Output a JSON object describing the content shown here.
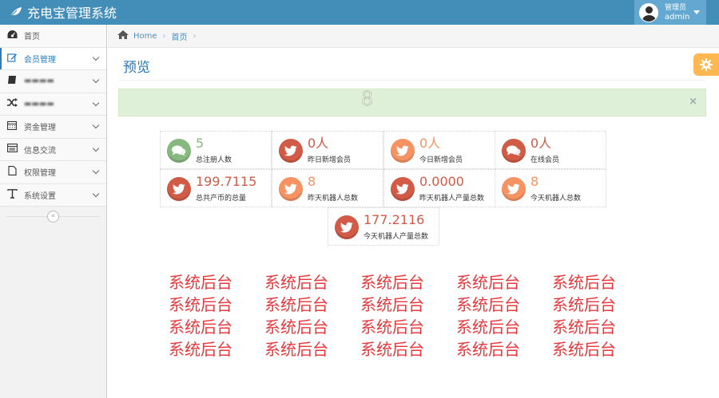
{
  "app": {
    "title": "充电宝管理系统"
  },
  "user": {
    "role": "管理员",
    "name": "admin"
  },
  "sidebar": {
    "items": [
      {
        "label": "首页",
        "icon": "dashboard-icon",
        "expandable": false
      },
      {
        "label": "会员管理",
        "icon": "edit-icon",
        "expandable": true,
        "active": true
      },
      {
        "label": "",
        "icon": "book-icon",
        "expandable": true,
        "obscured": true
      },
      {
        "label": "",
        "icon": "shuffle-icon",
        "expandable": true,
        "obscured": true
      },
      {
        "label": "资金管理",
        "icon": "calendar-icon",
        "expandable": true
      },
      {
        "label": "信息交流",
        "icon": "list-icon",
        "expandable": true
      },
      {
        "label": "权限管理",
        "icon": "file-icon",
        "expandable": true
      },
      {
        "label": "系统设置",
        "icon": "text-icon",
        "expandable": true
      }
    ],
    "collapse_symbol": "«"
  },
  "breadcrumb": {
    "home": "Home",
    "current": "首页"
  },
  "page": {
    "title": "预览"
  },
  "alert": {
    "text": "8",
    "close": "×"
  },
  "stats": [
    {
      "value": "5",
      "label": "总注册人数",
      "color": "#87b87f",
      "icon": "comments-icon"
    },
    {
      "value": "0人",
      "label": "昨日新增会员",
      "color": "#d15b47",
      "icon": "twitter-icon"
    },
    {
      "value": "0人",
      "label": "今日新增会员",
      "color": "#f79263",
      "icon": "twitter-icon"
    },
    {
      "value": "0人",
      "label": "在线会员",
      "color": "#d15b47",
      "icon": "comments-icon"
    },
    {
      "value": "199.7115",
      "label": "总共产币的总量",
      "color": "#d15b47",
      "icon": "twitter-icon"
    },
    {
      "value": "8",
      "label": "昨天机器人总数",
      "color": "#f79263",
      "icon": "twitter-icon"
    },
    {
      "value": "0.0000",
      "label": "昨天机器人产量总数",
      "color": "#d15b47",
      "icon": "twitter-icon"
    },
    {
      "value": "8",
      "label": "今天机器人总数",
      "color": "#f79263",
      "icon": "twitter-icon"
    },
    {
      "value": "177.2116",
      "label": "今天机器人产量总数",
      "color": "#d15b47",
      "icon": "twitter-icon"
    }
  ],
  "repeated_text": [
    "系统后台",
    "系统后台",
    "系统后台",
    "系统后台",
    "系统后台",
    "系统后台",
    "系统后台",
    "系统后台",
    "系统后台",
    "系统后台",
    "系统后台",
    "系统后台",
    "系统后台",
    "系统后台",
    "系统后台",
    "系统后台",
    "系统后台",
    "系统后台",
    "系统后台",
    "系统后台"
  ],
  "colors": {
    "navbar": "#438eb9",
    "accent": "#2679b5",
    "alert_bg": "#dff0d8",
    "warning": "#ffb752",
    "red_text": "#e7393d"
  }
}
